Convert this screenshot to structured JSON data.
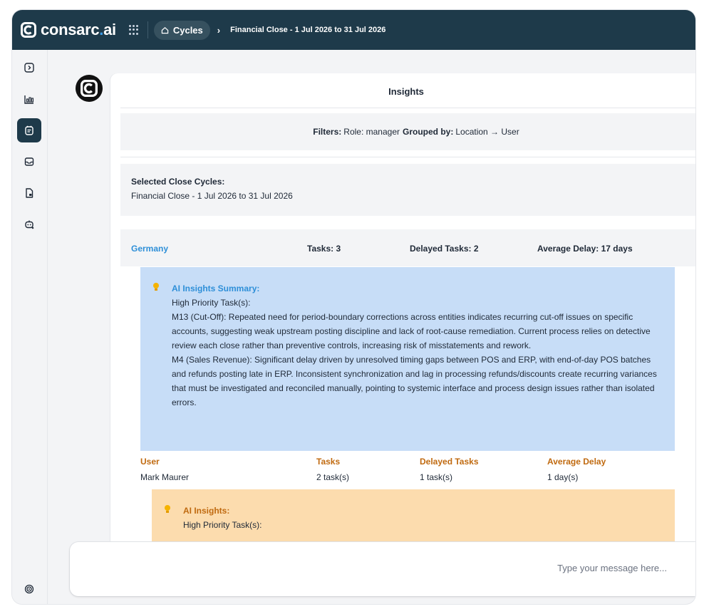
{
  "topbar": {
    "logo_text_main": "consarc",
    "logo_text_dot": ".",
    "logo_text_suffix": "ai",
    "icon": "apps-grid-icon",
    "nav_pill_label": "Cycles",
    "breadcrumb_current": "Financial Close - 1 Jul 2026 to 31 Jul 2026"
  },
  "sidebar": {
    "items": [
      {
        "name": "toggle-sidebar-icon",
        "active": false
      },
      {
        "name": "chart-icon",
        "active": false
      },
      {
        "name": "calendar-tasks-icon",
        "active": true
      },
      {
        "name": "inbox-icon",
        "active": false
      },
      {
        "name": "document-icon",
        "active": false
      },
      {
        "name": "bot-icon",
        "active": false
      }
    ],
    "bottom_icon": "settings-target-icon"
  },
  "insights": {
    "title": "Insights",
    "filters": {
      "label": "Filters:",
      "role": "Role: manager",
      "grouped_label": "Grouped by:",
      "grouped_value": "Location → User"
    },
    "selected_cycles": {
      "label": "Selected Close Cycles:",
      "value": "Financial Close - 1 Jul 2026 to 31 Jul 2026"
    },
    "group": {
      "name": "Germany",
      "tasks": "Tasks: 3",
      "delayed": "Delayed Tasks: 2",
      "avg_delay": "Average Delay: 17 days"
    },
    "ai_summary": {
      "heading": "AI Insights Summary:",
      "line1": "High Priority Task(s):",
      "para1": "M13 (Cut-Off): Repeated need for period-boundary corrections across entities indicates recurring cut-off issues on specific accounts, suggesting weak upstream posting discipline and lack of root-cause remediation. Current process relies on detective review each close rather than preventive controls, increasing risk of misstatements and rework.",
      "para2": "M4 (Sales Revenue): Significant delay driven by unresolved timing gaps between POS and ERP, with end-of-day POS batches and refunds posting late in ERP. Inconsistent synchronization and lag in processing refunds/discounts create recurring variances that must be investigated and reconciled manually, pointing to systemic interface and process design issues rather than isolated errors."
    },
    "user_table": {
      "headers": [
        "User",
        "Tasks",
        "Delayed Tasks",
        "Average Delay"
      ],
      "rows": [
        [
          "Mark Maurer",
          "2 task(s)",
          "1 task(s)",
          "1 day(s)"
        ]
      ]
    },
    "ai_insights": {
      "heading": "AI Insights:",
      "line1": "High Priority Task(s):"
    }
  },
  "chat": {
    "placeholder": "Type your message here..."
  },
  "colors": {
    "topbar": "#1e3a4a",
    "accent_blue": "#2e8fd8",
    "summary_bg": "#c7ddf7",
    "insights_bg": "#fcdcae",
    "orange_text": "#c06a10"
  }
}
